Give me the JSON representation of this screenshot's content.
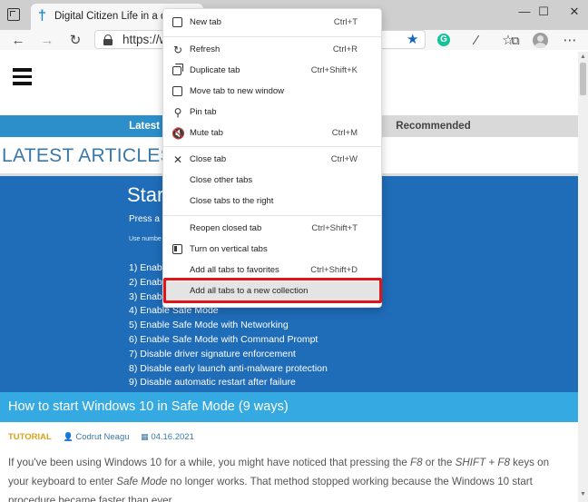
{
  "browser": {
    "tab_title": "Digital Citizen Life in a digital w",
    "url": "https://w",
    "window_buttons": {
      "minimize": "—",
      "maximize": "☐",
      "close": "✕"
    },
    "accent_color": "#1565c0"
  },
  "page": {
    "category_tabs": [
      "Latest",
      "Recommended"
    ],
    "latest_heading": "LATEST ARTICLES",
    "hero": {
      "title": "Star",
      "press": "Press a n",
      "use": "Use numbe",
      "list": [
        "1) Enable",
        "2) Enable",
        "3) Enab",
        "4) Enable Safe Mode",
        "5) Enable Safe Mode with Networking",
        "6) Enable Safe Mode with Command Prompt",
        "7) Disable driver signature enforcement",
        "8) Disable early launch anti-malware protection",
        "9) Disable automatic restart after failure"
      ]
    },
    "article": {
      "title": "How to start Windows 10 in Safe Mode (9 ways)",
      "tag": "TUTORIAL",
      "author": "Codrut Neagu",
      "date": "04.16.2021",
      "body_parts": {
        "p1": "If you've been using Windows 10 for a while, you might have noticed that pressing the ",
        "k1": "F8",
        "p2": " or the ",
        "k2": "SHIFT + F8",
        "p3": " keys on your keyboard to enter ",
        "k3": "Safe Mode",
        "p4": " no longer works. That method stopped working because the Windows 10 start procedure became faster than ever …"
      }
    }
  },
  "menu": {
    "items": [
      {
        "label": "New tab",
        "shortcut": "Ctrl+T",
        "icon": "new-tab-icon"
      },
      {
        "label": "Refresh",
        "shortcut": "Ctrl+R",
        "icon": "refresh-icon"
      },
      {
        "label": "Duplicate tab",
        "shortcut": "Ctrl+Shift+K",
        "icon": "duplicate-icon"
      },
      {
        "label": "Move tab to new window",
        "shortcut": "",
        "icon": "window-icon"
      },
      {
        "label": "Pin tab",
        "shortcut": "",
        "icon": "pin-icon"
      },
      {
        "label": "Mute tab",
        "shortcut": "Ctrl+M",
        "icon": "mute-icon"
      },
      {
        "label": "Close tab",
        "shortcut": "Ctrl+W",
        "icon": "close-icon"
      },
      {
        "label": "Close other tabs",
        "shortcut": "",
        "icon": ""
      },
      {
        "label": "Close tabs to the right",
        "shortcut": "",
        "icon": ""
      },
      {
        "label": "Reopen closed tab",
        "shortcut": "Ctrl+Shift+T",
        "icon": ""
      },
      {
        "label": "Turn on vertical tabs",
        "shortcut": "",
        "icon": "vertical-tabs-icon"
      },
      {
        "label": "Add all tabs to favorites",
        "shortcut": "Ctrl+Shift+D",
        "icon": ""
      },
      {
        "label": "Add all tabs to a new collection",
        "shortcut": "",
        "icon": ""
      }
    ],
    "highlight_color": "#e0141b"
  }
}
